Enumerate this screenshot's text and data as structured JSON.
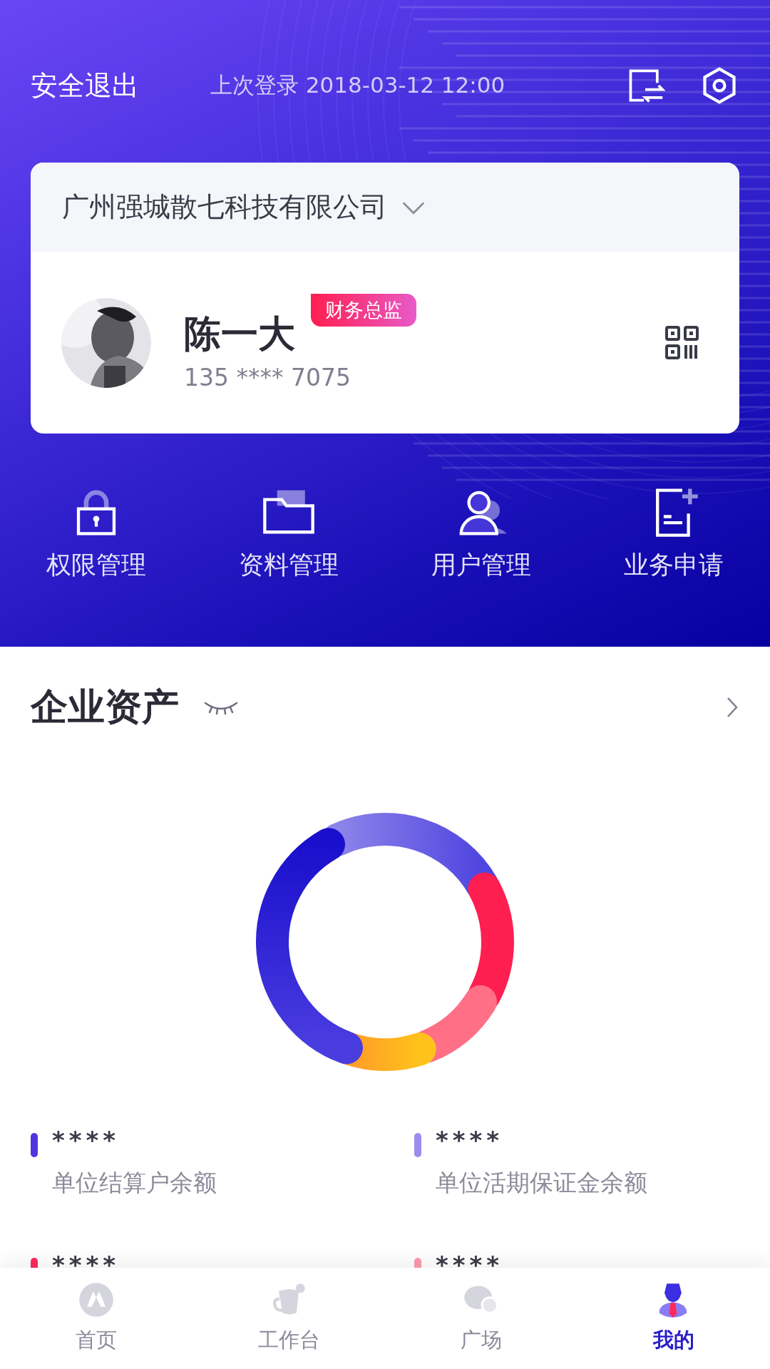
{
  "header": {
    "logout": "安全退出",
    "last_login": "上次登录 2018-03-12 12:00"
  },
  "account_card": {
    "company": "广州强城散七科技有限公司",
    "name": "陈一大",
    "role_badge": "财务总监",
    "phone": "135 **** 7075"
  },
  "shortcuts": [
    {
      "kind": "lock",
      "label": "权限管理"
    },
    {
      "kind": "folder",
      "label": "资料管理"
    },
    {
      "kind": "user",
      "label": "用户管理"
    },
    {
      "kind": "doc",
      "label": "业务申请"
    }
  ],
  "assets": {
    "title": "企业资产",
    "items": [
      {
        "amount": "****",
        "label": "单位结算户余额",
        "color": "#4f35e0"
      },
      {
        "amount": "****",
        "label": "单位活期保证金余额",
        "color": "#9a8cf0"
      },
      {
        "amount": "****",
        "color": "#ff2a5a"
      },
      {
        "amount": "****",
        "color": "#ff9aae"
      }
    ]
  },
  "tab_bar": [
    {
      "kind": "home",
      "label": "首页",
      "selected": false
    },
    {
      "kind": "work",
      "label": "工作台",
      "selected": false
    },
    {
      "kind": "square",
      "label": "广场",
      "selected": false
    },
    {
      "kind": "me",
      "label": "我的",
      "selected": true
    }
  ]
}
